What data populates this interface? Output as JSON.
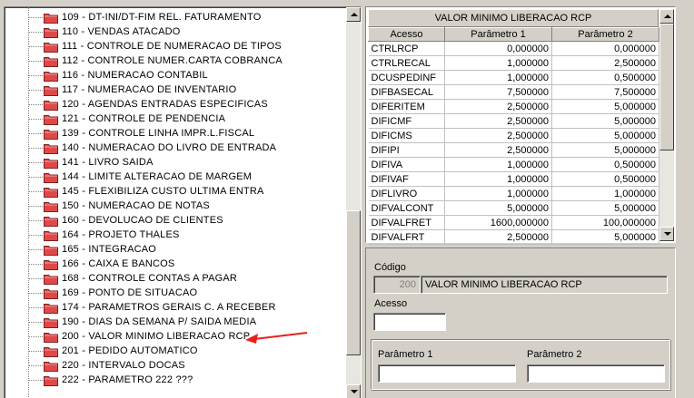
{
  "tree": {
    "items": [
      {
        "label": "109 - DT-INI/DT-FIM REL. FATURAMENTO"
      },
      {
        "label": "110 - VENDAS ATACADO"
      },
      {
        "label": "111 - CONTROLE DE NUMERACAO DE TIPOS"
      },
      {
        "label": "112 - CONTROLE NUMER.CARTA COBRANCA"
      },
      {
        "label": "116 - NUMERACAO CONTABIL"
      },
      {
        "label": "117 - NUMERACAO DE INVENTARIO"
      },
      {
        "label": "120 - AGENDAS ENTRADAS ESPECIFICAS"
      },
      {
        "label": "121 - CONTROLE DE PENDENCIA"
      },
      {
        "label": "139 - CONTROLE LINHA IMPR.L.FISCAL"
      },
      {
        "label": "140 - NUMERACAO DO LIVRO DE ENTRADA"
      },
      {
        "label": "141 - LIVRO SAIDA"
      },
      {
        "label": "144 - LIMITE ALTERACAO DE MARGEM"
      },
      {
        "label": "145 - FLEXIBILIZA CUSTO ULTIMA ENTRA"
      },
      {
        "label": "150 - NUMERACAO DE NOTAS"
      },
      {
        "label": "160 - DEVOLUCAO DE CLIENTES"
      },
      {
        "label": "164 - PROJETO THALES"
      },
      {
        "label": "165 - INTEGRACAO"
      },
      {
        "label": "166 - CAIXA E BANCOS"
      },
      {
        "label": "168 - CONTROLE CONTAS A PAGAR"
      },
      {
        "label": "169 - PONTO DE SITUACAO"
      },
      {
        "label": "174 - PARAMETROS GERAIS C. A RECEBER"
      },
      {
        "label": "190 - DIAS DA SEMANA P/ SAIDA MEDIA"
      },
      {
        "label": "200 - VALOR MINIMO LIBERACAO RCP"
      },
      {
        "label": "201 - PEDIDO AUTOMATICO"
      },
      {
        "label": "220 - INTERVALO DOCAS"
      },
      {
        "label": "222 - PARAMETRO 222 ???"
      }
    ]
  },
  "grid": {
    "title": "VALOR MINIMO LIBERACAO RCP",
    "columns": [
      "Acesso",
      "Parâmetro 1",
      "Parâmetro 2"
    ],
    "rows": [
      [
        "CTRLRCP",
        "0,000000",
        "0,000000"
      ],
      [
        "CTRLRECAL",
        "1,000000",
        "2,500000"
      ],
      [
        "DCUSPEDINF",
        "1,000000",
        "0,500000"
      ],
      [
        "DIFBASECAL",
        "7,500000",
        "7,500000"
      ],
      [
        "DIFERITEM",
        "2,500000",
        "5,000000"
      ],
      [
        "DIFICMF",
        "2,500000",
        "5,000000"
      ],
      [
        "DIFICMS",
        "2,500000",
        "5,000000"
      ],
      [
        "DIFIPI",
        "2,500000",
        "5,000000"
      ],
      [
        "DIFIVA",
        "1,000000",
        "0,500000"
      ],
      [
        "DIFIVAF",
        "1,000000",
        "0,500000"
      ],
      [
        "DIFLIVRO",
        "1,000000",
        "1,000000"
      ],
      [
        "DIFVALCONT",
        "5,000000",
        "5,000000"
      ],
      [
        "DIFVALFRET",
        "1600,000000",
        "100,000000"
      ],
      [
        "DIFVALFRT",
        "2,500000",
        "5,000000"
      ]
    ]
  },
  "form": {
    "codigo_label": "Código",
    "codigo_value": "200",
    "descricao_value": "VALOR MINIMO LIBERACAO RCP",
    "acesso_label": "Acesso",
    "acesso_value": "",
    "param1_label": "Parâmetro 1",
    "param1_value": "",
    "param2_label": "Parâmetro 2",
    "param2_value": ""
  },
  "colors": {
    "window_bg": "#d4d0c8",
    "folder": "#e04848",
    "annotation_arrow": "#e8201c"
  },
  "icons": [
    "folder-icon",
    "scroll-up-arrow-icon",
    "scroll-down-arrow-icon",
    "red-annotation-arrow-icon"
  ]
}
